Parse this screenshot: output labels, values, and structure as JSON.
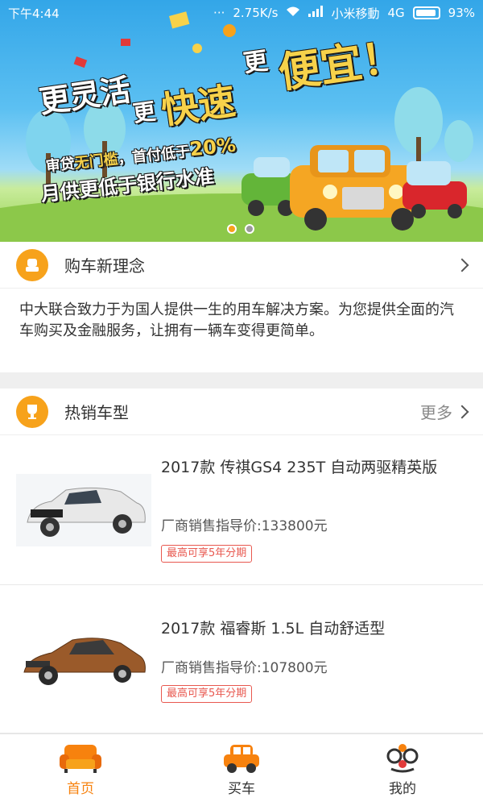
{
  "status_bar": {
    "time": "下午4:44",
    "dots": "···",
    "speed": "2.75K/s",
    "carrier": "小米移動",
    "network": "4G",
    "battery": "93%"
  },
  "banner": {
    "slogan_1": "更灵活",
    "slogan_2": "更",
    "slogan_3": "快速",
    "slogan_4": "更",
    "slogan_5": "便宜！",
    "line_1_prefix": "审贷",
    "line_1_highlight": "无门槛",
    "line_1_suffix": "，首付低于",
    "line_1_percent": "20%",
    "line_2": "月供更低于银行水准",
    "indicator_count": 2,
    "active_indicator": 0
  },
  "concept": {
    "title": "购车新理念",
    "description": "中大联合致力于为国人提供一生的用车解决方案。为您提供全面的汽车购买及金融服务，让拥有一辆车变得更简单。"
  },
  "hot_models": {
    "title": "热销车型",
    "more_label": "更多",
    "items": [
      {
        "title": "2017款 传祺GS4 235T 自动两驱精英版",
        "price": "厂商销售指导价:133800元",
        "badge": "最高可享5年分期",
        "car_color": "#e8e8e8"
      },
      {
        "title": "2017款 福睿斯 1.5L 自动舒适型",
        "price": "厂商销售指导价:107800元",
        "badge": "最高可享5年分期",
        "car_color": "#9a5a2a"
      }
    ]
  },
  "tabbar": {
    "items": [
      {
        "label": "首页",
        "icon": "sofa-icon",
        "active": true
      },
      {
        "label": "买车",
        "icon": "car-icon",
        "active": false
      },
      {
        "label": "我的",
        "icon": "mask-glasses-icon",
        "active": false
      }
    ]
  },
  "colors": {
    "accent": "#f7820e",
    "badge_red": "#e8584f",
    "icon_orange": "#f7a21b"
  }
}
